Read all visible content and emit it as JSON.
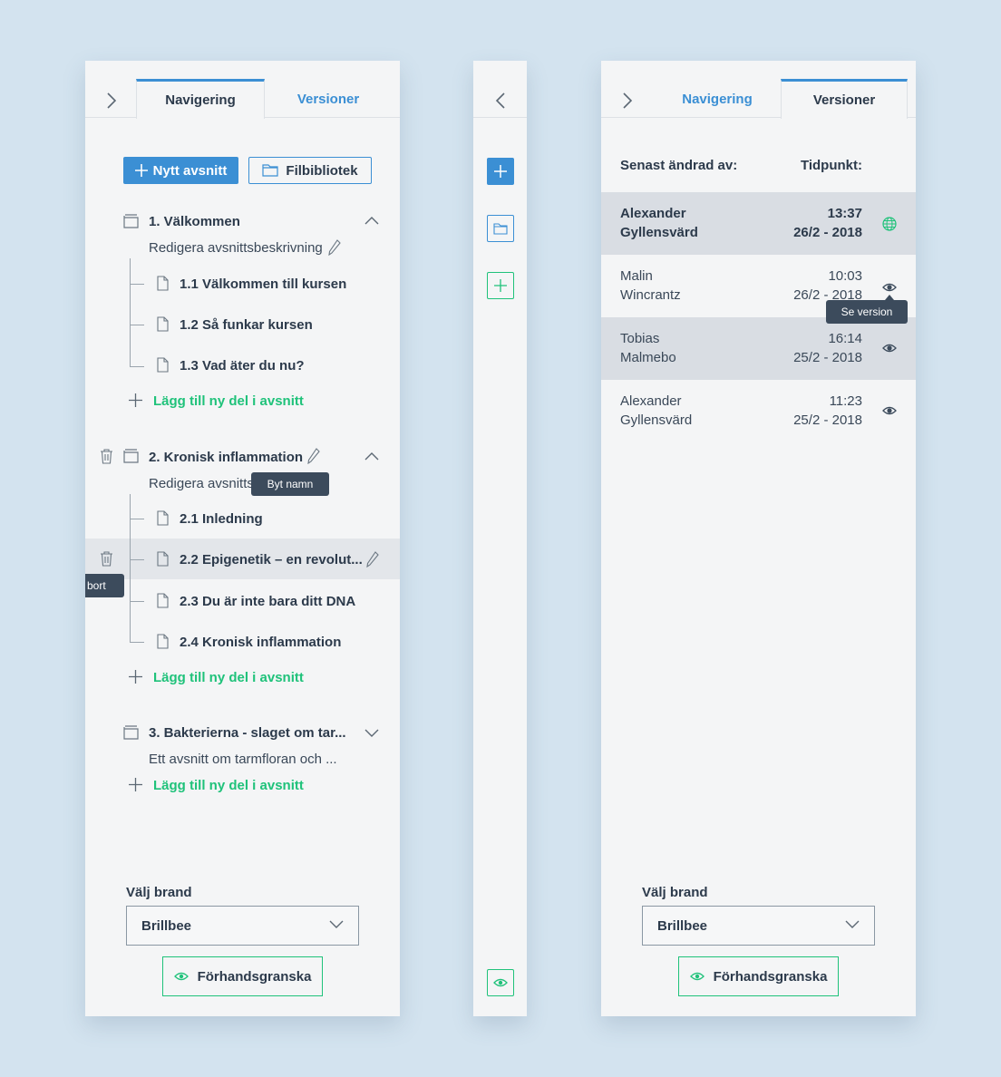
{
  "left_panel": {
    "tabs": {
      "navigation": "Navigering",
      "versions": "Versioner"
    },
    "buttons": {
      "new_section": "Nytt avsnitt",
      "file_library": "Filbibliotek"
    },
    "sections": [
      {
        "title": "1. Välkommen",
        "description": "Redigera avsnittsbeskrivning",
        "items": [
          "1.1 Välkommen till kursen",
          "1.2 Så funkar kursen",
          "1.3 Vad äter du nu?"
        ],
        "add_label": "Lägg till ny del i avsnitt"
      },
      {
        "title": "2. Kronisk inflammation",
        "description": "Redigera avsnitts",
        "items": [
          "2.1 Inledning",
          "2.2 Epigenetik – en revolut...",
          "2.3 Du är inte bara ditt DNA",
          "2.4 Kronisk inflammation"
        ],
        "add_label": "Lägg till ny del i avsnitt"
      },
      {
        "title": "3. Bakterierna - slaget om tar...",
        "description": "Ett avsnitt om tarmfloran och ...",
        "add_label": "Lägg till ny del i avsnitt"
      }
    ],
    "tooltips": {
      "rename": "Byt namn",
      "delete": "bort"
    },
    "brand_label": "Välj brand",
    "brand_value": "Brillbee",
    "preview_label": "Förhandsgranska"
  },
  "right_panel": {
    "tabs": {
      "navigation": "Navigering",
      "versions": "Versioner"
    },
    "columns": {
      "changed_by": "Senast ändrad av:",
      "time": "Tidpunkt:"
    },
    "versions": [
      {
        "first": "Alexander",
        "last": "Gyllensvärd",
        "time": "13:37",
        "date": "26/2 - 2018",
        "icon": "globe-icon"
      },
      {
        "first": "Malin",
        "last": "Wincrantz",
        "time": "10:03",
        "date": "26/2 - 2018",
        "icon": "eye-icon"
      },
      {
        "first": "Tobias",
        "last": "Malmebo",
        "time": "16:14",
        "date": "25/2 - 2018",
        "icon": "eye-icon"
      },
      {
        "first": "Alexander",
        "last": "Gyllensvärd",
        "time": "11:23",
        "date": "25/2 - 2018",
        "icon": "eye-icon"
      }
    ],
    "tooltip_view": "Se version",
    "brand_label": "Välj brand",
    "brand_value": "Brillbee",
    "preview_label": "Förhandsgranska"
  },
  "colors": {
    "accent": "#3b8fd4",
    "green": "#1fc27a",
    "background": "#d3e3ef",
    "panel": "#f4f5f6",
    "tooltip": "#3c4b5c",
    "highlight": "#e3e6ea",
    "selected_row": "#d9dde3"
  }
}
